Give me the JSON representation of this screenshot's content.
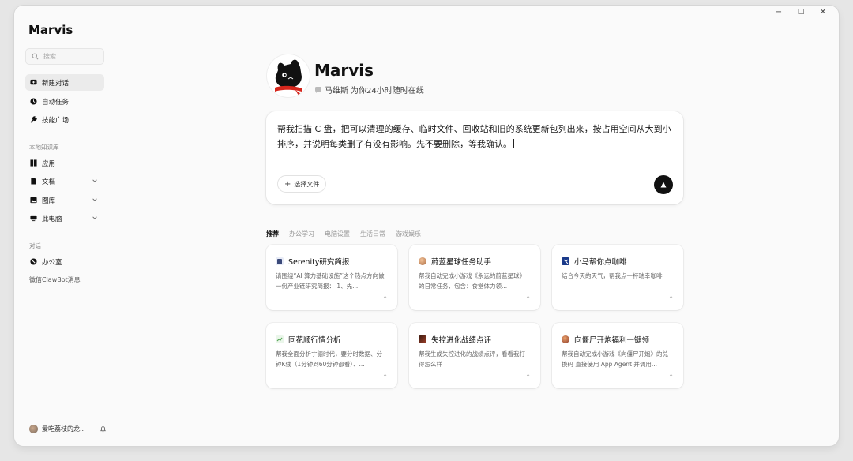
{
  "window": {
    "controls": {
      "minimize": "−",
      "maximize": "□",
      "close": "✕"
    }
  },
  "sidebar": {
    "app_name": "Marvis",
    "search_placeholder": "搜索",
    "primary_items": [
      {
        "label": "新建对话",
        "icon": "new-chat-icon",
        "active": true
      },
      {
        "label": "自动任务",
        "icon": "clock-icon"
      },
      {
        "label": "技能广场",
        "icon": "wrench-icon"
      }
    ],
    "knowledge_label": "本地知识库",
    "knowledge_items": [
      {
        "label": "应用",
        "icon": "grid-icon"
      },
      {
        "label": "文档",
        "icon": "document-icon",
        "expandable": true
      },
      {
        "label": "图库",
        "icon": "image-icon",
        "expandable": true
      },
      {
        "label": "此电脑",
        "icon": "monitor-icon",
        "expandable": true
      }
    ],
    "conversation_label": "对话",
    "conversation_items": [
      {
        "label": "办公室",
        "icon": "office-icon"
      }
    ],
    "wechat_label": "微信ClawBot消息",
    "user_name": "爱吃荔枝的龙..."
  },
  "hero": {
    "title": "Marvis",
    "subtitle_prefix": "马维斯",
    "subtitle": "为你24小时随时在线"
  },
  "composer": {
    "text": "帮我扫描 C 盘，把可以清理的缓存、临时文件、回收站和旧的系统更新包列出来，按占用空间从大到小排序，并说明每类删了有没有影响。先不要删除，等我确认。",
    "file_button": "选择文件"
  },
  "tabs": [
    {
      "label": "推荐",
      "active": true
    },
    {
      "label": "办公学习"
    },
    {
      "label": "电脑设置"
    },
    {
      "label": "生活日常"
    },
    {
      "label": "游戏娱乐"
    }
  ],
  "cards": [
    {
      "title": "Serenity研究简报",
      "desc": "请围绕“AI 算力基础设施”这个热点方向做一份产业链研究简报： 1、先...",
      "icon": "report-icon",
      "color": "#3b4a7a"
    },
    {
      "title": "蔚蓝星球任务助手",
      "desc": "帮我自动完成小游戏《永远的蔚蓝星球》的日常任务，包含：食堂体力领...",
      "icon": "game-avatar-icon",
      "color": "#c98a5a"
    },
    {
      "title": "小马帮你点咖啡",
      "desc": "结合今天的天气，帮我点一杯瑞幸咖啡",
      "icon": "coffee-brand-icon",
      "color": "#1a3a8a"
    },
    {
      "title": "同花顺行情分析",
      "desc": "帮我全面分析宁德时代，要分时数据、分钟K线（1分钟到60分钟都看）、...",
      "icon": "stock-icon",
      "color": "#7bbf7b"
    },
    {
      "title": "失控进化战绩点评",
      "desc": "帮我生成失控进化的战绩点评，看看我打得怎么样",
      "icon": "game-icon",
      "color": "#7a2a1a"
    },
    {
      "title": "向僵尸开炮福利一键领",
      "desc": "帮我自动完成小游戏《向僵尸开炮》的兑换码 直接使用 App Agent 并调用...",
      "icon": "zombie-game-icon",
      "color": "#b54a3a"
    }
  ],
  "card_arrow": "↑"
}
